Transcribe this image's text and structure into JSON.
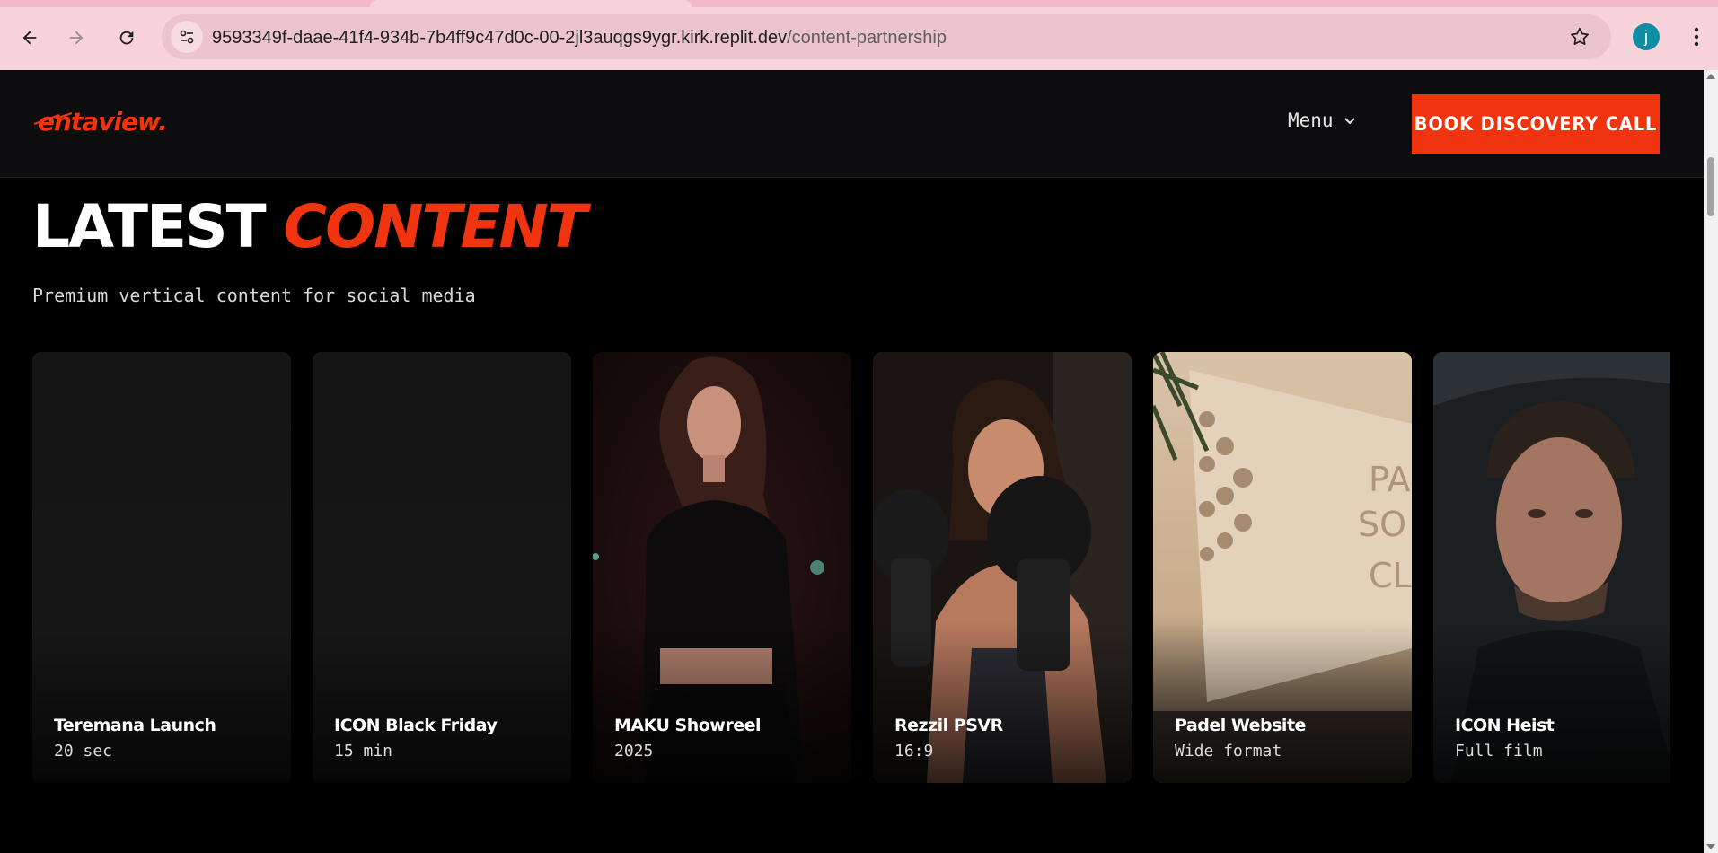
{
  "browser": {
    "url_host": "9593349f-daae-41f4-934b-7b4ff9c47d0c-00-2jl3auqgs9ygr.kirk.replit.dev",
    "url_path": "/content-partnership",
    "profile_initial": "j",
    "icons": [
      "back-arrow-icon",
      "forward-arrow-icon",
      "reload-icon",
      "site-info-icon",
      "bookmark-star-icon",
      "kebab-menu-icon"
    ]
  },
  "header": {
    "logo_text": "entaview.",
    "menu_label": "Menu",
    "cta_label": "BOOK DISCOVERY CALL",
    "accent_color": "#f0340f"
  },
  "section": {
    "title_white": "LATEST",
    "title_accent": "CONTENT",
    "subtitle": "Premium vertical content for social media"
  },
  "cards": [
    {
      "title": "Teremana Launch",
      "meta": "20 sec"
    },
    {
      "title": "ICON Black Friday",
      "meta": "15 min"
    },
    {
      "title": "MAKU Showreel",
      "meta": "2025"
    },
    {
      "title": "Rezzil PSVR",
      "meta": "16:9"
    },
    {
      "title": "Padel Website",
      "meta": "Wide format"
    },
    {
      "title": "ICON Heist",
      "meta": "Full film"
    }
  ]
}
